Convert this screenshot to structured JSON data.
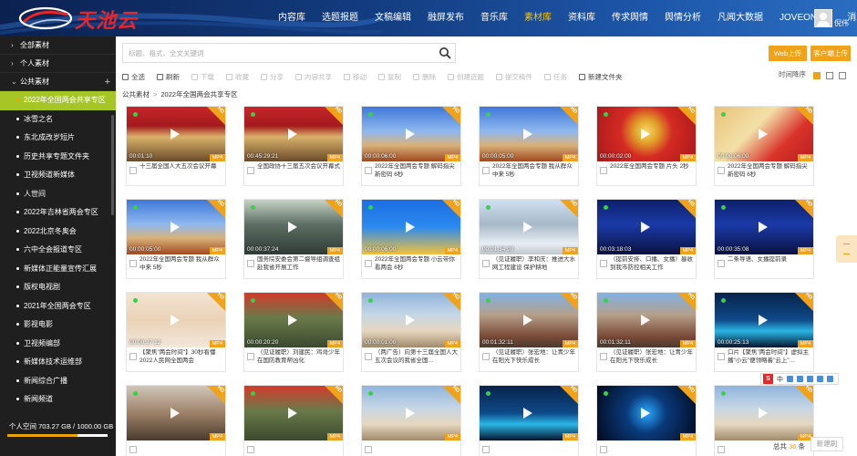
{
  "header": {
    "logo_text": "天池云",
    "nav": [
      "内容库",
      "选题报题",
      "文稿编辑",
      "融屏发布",
      "音乐库",
      "素材库",
      "资料库",
      "传求舆情",
      "舆情分析",
      "凡闻大数据",
      "JOVEONE",
      "消息"
    ],
    "active_nav": 5,
    "username": "倪伟"
  },
  "sidebar": {
    "top_items": [
      "全部素材",
      "个人素材",
      "公共素材"
    ],
    "sub_items": [
      "2022年全国两会共享专区",
      "冰雪之名",
      "东北成改岁短片",
      "历史共享专题文件夹",
      "卫视频道新媒体",
      "人世间",
      "2022年吉林省两会专区",
      "2022北京冬奥会",
      "六中全会报道专区",
      "新媒体正能量宣传汇展",
      "版权电视剧",
      "2021年全国两会专区",
      "影视电影",
      "卫视频编部",
      "新媒体技术运维部",
      "新闻综合广播",
      "新闻频道"
    ],
    "active_sub": 0,
    "storage_label": "个人空间 703.27 GB / 1000.00 GB",
    "storage_fraction": 0.703
  },
  "search": {
    "placeholder": "标题、格式、全文关键词"
  },
  "buttons": {
    "web_upload": "Web上传",
    "client_upload": "客户端上传",
    "refresh": "新建刷"
  },
  "toolbar": {
    "items": [
      "全选",
      "刷新",
      "下载",
      "收藏",
      "分享",
      "内容共享",
      "移动",
      "复制",
      "删除",
      "创建选题",
      "提交稿件",
      "任务",
      "新建文件夹"
    ],
    "enabled": [
      0,
      1,
      12
    ],
    "sort": "时间降序"
  },
  "breadcrumb": [
    "公共素材",
    "2022年全国两会共享专区"
  ],
  "cards": [
    {
      "timecode": "00:01:10",
      "caption": "十三届全国人大五次会议开幕",
      "theme": "hall"
    },
    {
      "timecode": "00:45:29:21",
      "caption": "全国政协十三届五次会议开幕式",
      "theme": "hall"
    },
    {
      "timecode": "00:00:06:00",
      "caption": "2022年全国两会专题 解码指尖新密码 6秒",
      "theme": "sky"
    },
    {
      "timecode": "00:00:05:00",
      "caption": "2022年全国两会专题 我从群众中来 5秒",
      "theme": "sky"
    },
    {
      "timecode": "00:00:02:00",
      "caption": "2022年全国两会专题 片头 2秒",
      "theme": "emblem"
    },
    {
      "timecode": "00:00:06:00",
      "caption": "2022年全国两会专题 解码指尖新密码 6秒",
      "theme": "gold"
    },
    {
      "timecode": "00:00:05:00",
      "caption": "2022年全国两会专题 我从群众中来 5秒",
      "theme": "sky"
    },
    {
      "timecode": "00:00:37:24",
      "caption": "国务院安委会第二督导组调查组赴我省开展工作",
      "theme": "meeting"
    },
    {
      "timecode": "00:00:06:00",
      "caption": "2022年全国两会专题 小云带你看两会 6秒",
      "theme": "banner"
    },
    {
      "timecode": "00:01:34:09",
      "caption": "（见证履职）李和庆：推进大水网工程建设 保护耕地",
      "theme": "city"
    },
    {
      "timecode": "00:03:18:03",
      "caption": "（提前安排、口播、女播）暴收到我市防控相关工作",
      "theme": "anchor"
    },
    {
      "timecode": "00:00:35:08",
      "caption": "二条导语、女播提前录",
      "theme": "anchor"
    },
    {
      "timecode": "00:00:27:12",
      "caption": "【聚焦\"两会时间\"】30秒看懂2022人民网全国两会",
      "theme": "pale"
    },
    {
      "timecode": "00:00:20:20",
      "caption": "（见证履职）刘建民：鸡哥少年在国防教育帮凶化",
      "theme": "soldiers"
    },
    {
      "timecode": "00:00:01:00",
      "caption": "（两广告）向第十三届全国人大五次会议的我省全国…",
      "theme": "building"
    },
    {
      "timecode": "00:01:32:11",
      "caption": "（见证履职）张宏地：让青少年在阳光下快乐成长",
      "theme": "tower"
    },
    {
      "timecode": "00:01:32:11",
      "caption": "（见证履职）张宏地：让青少年在阳光下快乐成长",
      "theme": "tower"
    },
    {
      "timecode": "00:00:25:13",
      "caption": "口片【聚焦\"两会时间\"】虚拟主播\"小云\"便领略着\"云上\"…",
      "theme": "tech"
    },
    {
      "timecode": "",
      "caption": "",
      "theme": "meeting2"
    },
    {
      "timecode": "",
      "caption": "",
      "theme": "soldiers"
    },
    {
      "timecode": "",
      "caption": "",
      "theme": "building"
    },
    {
      "timecode": "",
      "caption": "",
      "theme": "tech"
    },
    {
      "timecode": "",
      "caption": "",
      "theme": "darktech"
    },
    {
      "timecode": "",
      "caption": "",
      "theme": "building"
    }
  ],
  "ime_label": "中",
  "footer": {
    "total_prefix": "总共",
    "total_count": "36",
    "total_suffix": "条"
  },
  "colors": {
    "accent": "#f0a21b",
    "active_sidebar": "#a6c628",
    "header": "#123a7c"
  }
}
